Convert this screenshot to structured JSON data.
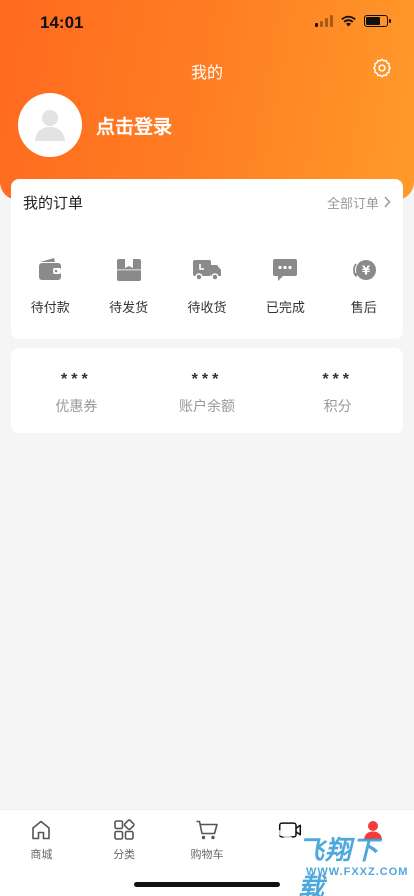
{
  "status_bar": {
    "time": "14:01"
  },
  "header": {
    "title": "我的",
    "login_text": "点击登录"
  },
  "orders": {
    "title": "我的订单",
    "all_label": "全部订单",
    "items": [
      {
        "label": "待付款",
        "icon": "wallet-icon"
      },
      {
        "label": "待发货",
        "icon": "box-icon"
      },
      {
        "label": "待收货",
        "icon": "truck-icon"
      },
      {
        "label": "已完成",
        "icon": "chat-icon"
      },
      {
        "label": "售后",
        "icon": "refund-icon"
      }
    ]
  },
  "assets": [
    {
      "value": "***",
      "label": "优惠券"
    },
    {
      "value": "***",
      "label": "账户余额"
    },
    {
      "value": "***",
      "label": "积分"
    }
  ],
  "tabbar": [
    {
      "label": "商城",
      "icon": "home-icon"
    },
    {
      "label": "分类",
      "icon": "grid-icon"
    },
    {
      "label": "购物车",
      "icon": "cart-icon"
    },
    {
      "label": "",
      "icon": "video-icon"
    },
    {
      "label": "",
      "icon": "profile-icon",
      "active": true
    }
  ],
  "watermark": {
    "text": "飞翔下载",
    "url": "WWW.FXXZ.COM"
  },
  "colors": {
    "accent": "#ff7a22",
    "active_tab": "#f43a3a",
    "icon_gray": "#8a8a8a"
  }
}
